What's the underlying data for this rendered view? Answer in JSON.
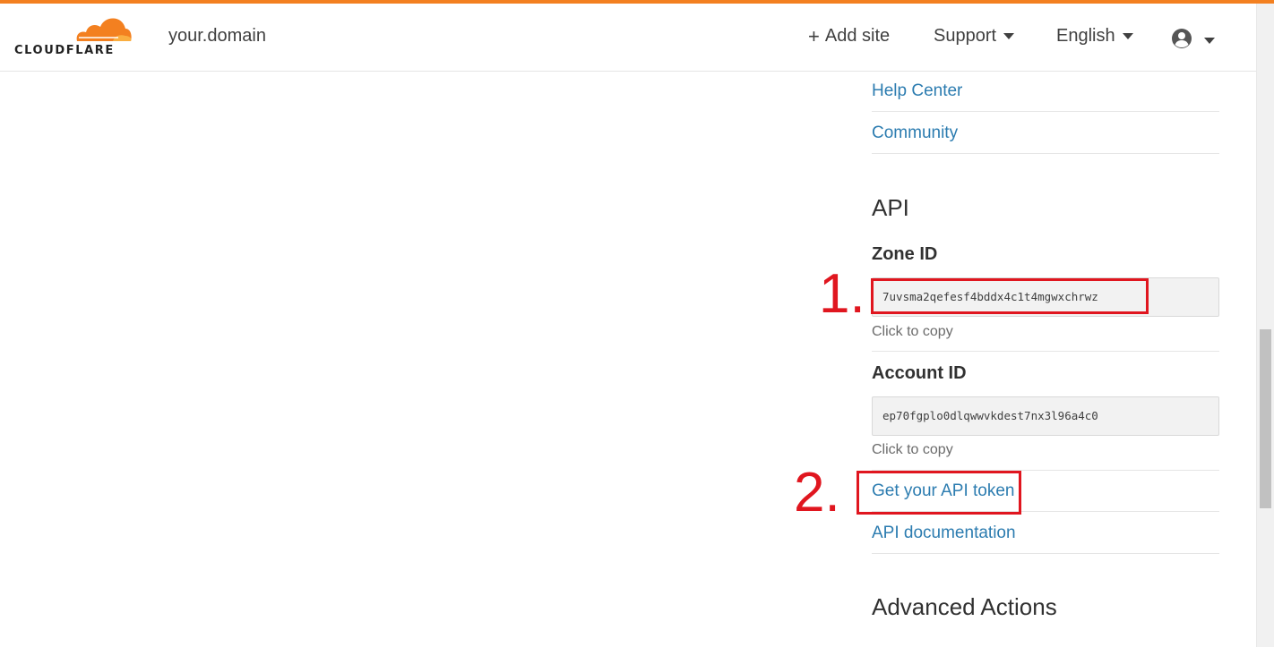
{
  "header": {
    "logo_text": "CLOUDFLARE",
    "domain": "your.domain",
    "add_site_label": "Add site",
    "support_label": "Support",
    "language_label": "English"
  },
  "sidebar": {
    "links_top": [
      {
        "label": "Help Center"
      },
      {
        "label": "Community"
      }
    ],
    "api": {
      "title": "API",
      "zone_id_label": "Zone ID",
      "zone_id_value": "7uvsma2qefesf4bddx4c1t4mgwxchrwz",
      "zone_hint": "Click to copy",
      "account_id_label": "Account ID",
      "account_id_value": "ep70fgplo0dlqwwvkdest7nx3l96a4c0",
      "account_hint": "Click to copy",
      "get_token_label": "Get your API token",
      "docs_label": "API documentation"
    },
    "advanced_title": "Advanced Actions"
  },
  "annotations": {
    "step1": "1.",
    "step2": "2.",
    "color": "#e0161f"
  },
  "colors": {
    "accent": "#f38020",
    "link": "#2c7cb0"
  }
}
